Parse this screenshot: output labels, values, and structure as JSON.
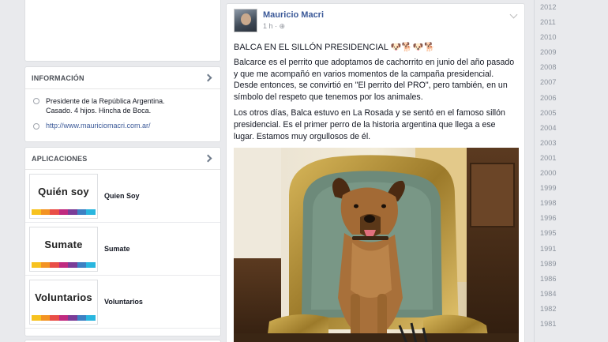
{
  "info": {
    "title": "INFORMACIÓN",
    "about": "Presidente de la República Argentina. Casado. 4 hijos. Hincha de Boca.",
    "website": "http://www.mauriciomacri.com.ar/"
  },
  "apps": {
    "title": "APLICACIONES",
    "items": [
      {
        "thumb": "Quién soy",
        "label": "Quien Soy"
      },
      {
        "thumb": "Sumate",
        "label": "Sumate"
      },
      {
        "thumb": "Voluntarios",
        "label": "Voluntarios"
      }
    ],
    "stripe_colors": [
      "#f7c21f",
      "#f39323",
      "#e94e47",
      "#c02a80",
      "#7a3d98",
      "#3d80c3",
      "#29b6df"
    ]
  },
  "post": {
    "author": "Mauricio Macri",
    "time": "1 h",
    "title": "BALCA EN EL SILLÓN PRESIDENCIAL",
    "title_emoji": "🐶🐕🐶🐕",
    "paragraph1": "Balcarce es el perrito que adoptamos de cachorrito en junio del año pasado y que me acompañó en varios momentos de la campaña presidencial. Desde entonces, se convirtió en \"El perrito del PRO\", pero también, en un símbolo del respeto que tenemos por los animales.",
    "paragraph2": "Los otros días, Balca estuvo en La Rosada y se sentó en el famoso sillón presidencial. Es el primer perro de la historia argentina que llega a ese lugar. Estamos muy orgullosos de él."
  },
  "timeline": {
    "years": [
      "2012",
      "2011",
      "2010",
      "2009",
      "2008",
      "2007",
      "2006",
      "2005",
      "2004",
      "2003",
      "2001",
      "2000",
      "1999",
      "1998",
      "1996",
      "1995",
      "1991",
      "1989",
      "1986",
      "1984",
      "1982",
      "1981"
    ]
  }
}
